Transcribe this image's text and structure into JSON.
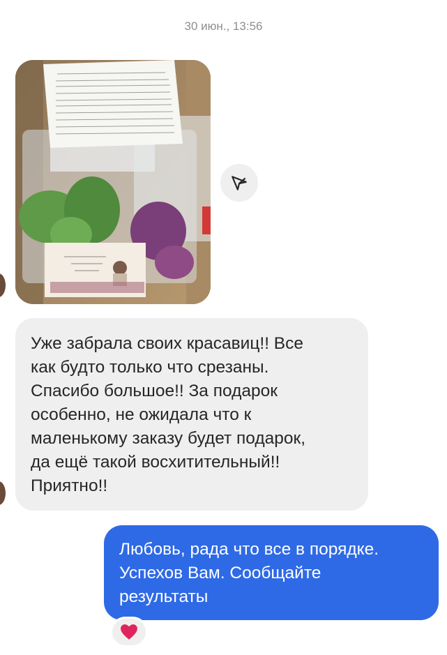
{
  "chat": {
    "timestamp": "30 июн., 13:56",
    "incoming_text": "Уже забрала своих красавиц!! Все\nкак будто только что срезаны.\nСпасибо большое!! За подарок\nособенно, не ожидала что к\nмаленькому заказу будет подарок,\nда ещё такой восхитительный!!\nПриятно!!",
    "outgoing_text": "Любовь, рада что все в порядке.\nУспехов Вам. Сообщайте\nрезультаты",
    "reaction_emoji": "❤️",
    "icons": {
      "share": "send-icon",
      "reaction": "heart-icon",
      "avatar": "avatar"
    },
    "colors": {
      "incoming_bubble": "#efefef",
      "outgoing_bubble": "#2f6ae6",
      "heart": "#e0245e"
    }
  }
}
